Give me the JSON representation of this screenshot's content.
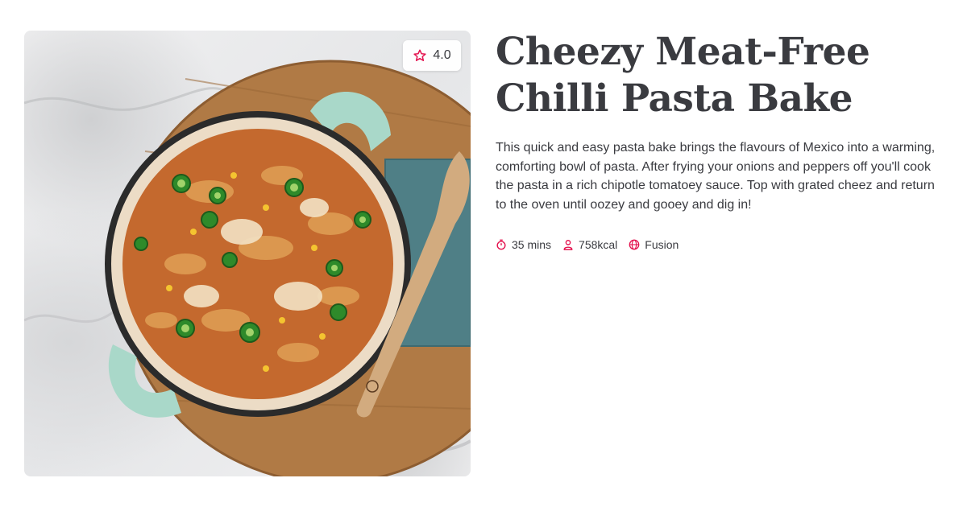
{
  "recipe": {
    "rating": "4.0",
    "title": "Cheezy Meat-Free Chilli Pasta Bake",
    "description": "This quick and easy pasta bake brings the flavours of Mexico into a warming, comforting bowl of pasta. After frying your onions and peppers off you'll cook the pasta in a rich chipotle tomatoey sauce. Top with grated cheez and return to the oven until oozey and gooey and dig in!",
    "meta": {
      "time": "35 mins",
      "calories": "758kcal",
      "cuisine": "Fusion"
    }
  },
  "icons": {
    "rating": "star-outline-icon",
    "time": "stopwatch-icon",
    "calories": "person-icon",
    "cuisine": "globe-icon"
  },
  "colors": {
    "accent": "#e4134f",
    "text": "#3a3b40",
    "pan_teal": "#a9d8c9"
  }
}
